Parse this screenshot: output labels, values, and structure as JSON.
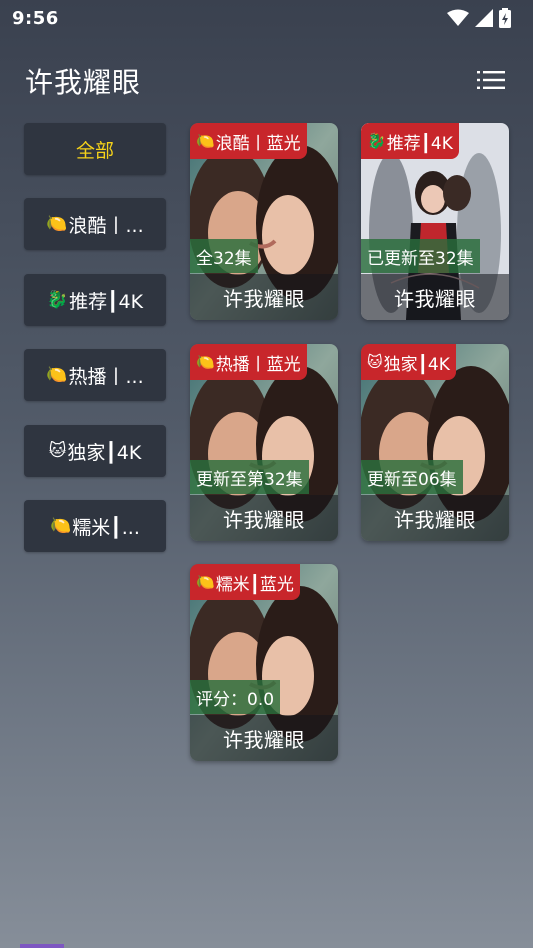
{
  "status": {
    "time": "9:56"
  },
  "header": {
    "title": "许我耀眼",
    "menu_icon": "list-menu-icon"
  },
  "sidebar": {
    "items": [
      {
        "label": "全部",
        "emoji": "",
        "active": true
      },
      {
        "label": "浪酷丨...",
        "emoji": "🍋"
      },
      {
        "label": "推荐┃4K",
        "emoji": "🐉"
      },
      {
        "label": "热播丨...",
        "emoji": "🍋"
      },
      {
        "label": "独家┃4K",
        "emoji": "🐱"
      },
      {
        "label": "糯米┃...",
        "emoji": "🍋"
      }
    ]
  },
  "cards": [
    {
      "badge": "浪酷丨蓝光",
      "badge_emoji": "🍋",
      "episode": "全32集",
      "title": "许我耀眼",
      "poster": "kiss"
    },
    {
      "badge": "推荐┃4K",
      "badge_emoji": "🐉",
      "episode": "已更新至32集",
      "title": "许我耀眼",
      "poster": "group"
    },
    {
      "badge": "热播丨蓝光",
      "badge_emoji": "🍋",
      "episode": "更新至第32集",
      "title": "许我耀眼",
      "poster": "kiss"
    },
    {
      "badge": "独家┃4K",
      "badge_emoji": "🐱",
      "episode": "更新至06集",
      "title": "许我耀眼",
      "poster": "kiss"
    },
    {
      "badge": "糯米┃蓝光",
      "badge_emoji": "🍋",
      "episode": "评分：0.0",
      "title": "许我耀眼",
      "poster": "kiss"
    }
  ],
  "colors": {
    "badge": "#c8262b",
    "active": "#f5d21a",
    "episode_bg": "#2a6e3c"
  }
}
